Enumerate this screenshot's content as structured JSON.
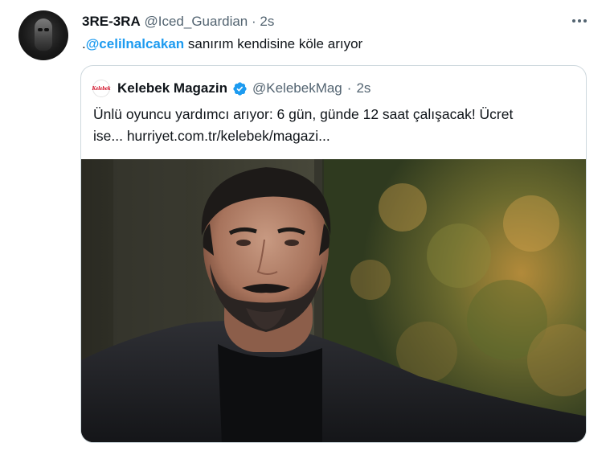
{
  "tweet": {
    "name": "3RE-3RA",
    "handle": "@Iced_Guardian",
    "separator": "·",
    "time": "2s",
    "text_prefix": ".",
    "mention": "@celilnalcakan",
    "text_rest": " sanırım kendisine köle arıyor"
  },
  "quoted": {
    "avatar_text": "Kelebek",
    "name": "Kelebek Magazin",
    "handle": "@KelebekMag",
    "separator": "·",
    "time": "2s",
    "line1": "Ünlü oyuncu yardımcı arıyor: 6 gün, günde 12 saat çalışacak! Ücret",
    "line2": "ise... hurriyet.com.tr/kelebek/magazi..."
  },
  "colors": {
    "link": "#1d9bf0",
    "secondary_text": "#536471",
    "border": "#cfd9de"
  },
  "icons": {
    "more": "more-horizontal-icon",
    "verified": "verified-badge-icon"
  }
}
